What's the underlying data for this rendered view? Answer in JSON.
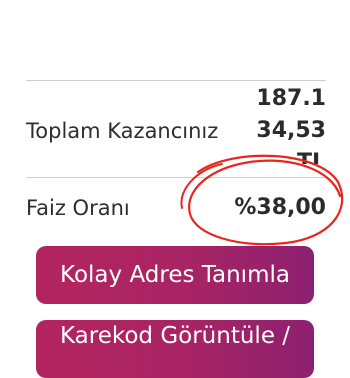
{
  "summary": {
    "prev_value_partial": "187.1",
    "earnings_label": "Toplam Kazancınız",
    "earnings_value": "34,53",
    "earnings_currency_partial": "TL",
    "rate_label": "Faiz Oranı",
    "rate_value": "%38,00"
  },
  "buttons": {
    "address_label": "Kolay Adres Tanımla",
    "qr_label": "Karekod Görüntüle /"
  },
  "colors": {
    "button_primary": "#a82464",
    "annotation_red": "#e8261f"
  }
}
